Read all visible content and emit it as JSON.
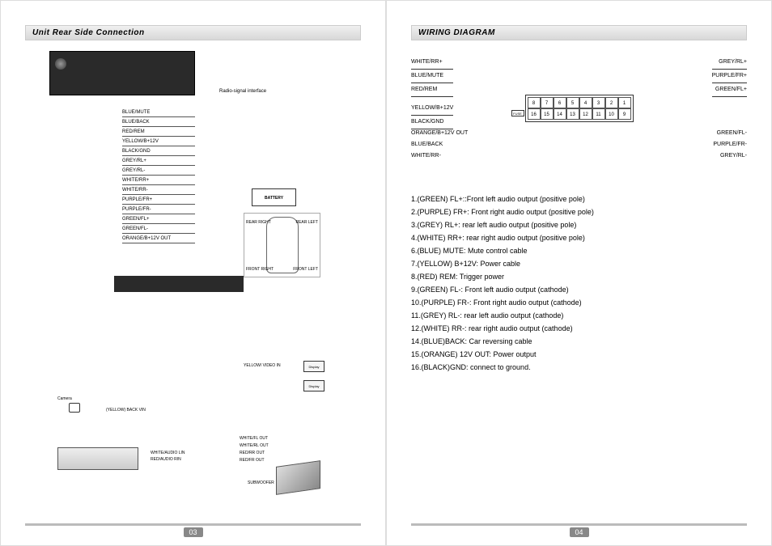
{
  "leftPage": {
    "title": "Unit Rear Side Connection",
    "radioInterface": "Radio-signal interface",
    "upperWires": [
      "BLUE/MUTE",
      "BLUE/BACK",
      "RED/REM",
      "YELLOW/B+12V",
      "BLACK/GND",
      "GREY/RL+",
      "GREY/RL-",
      "WHITE/RR+",
      "WHITE/RR-",
      "PURPLE/FR+",
      "PURPLE/FR-",
      "GREEN/FL+",
      "GREEN/FL-",
      "ORANGE/B+12V OUT"
    ],
    "battery": "BATTERY",
    "carLabels": {
      "rr": "REAR RIGHT",
      "rl": "REAR LEFT",
      "fr": "FRONT RIGHT",
      "fl": "FRONT LEFT"
    },
    "camera": "Camera",
    "cameraWire": "(YELLOW) BACK VIN",
    "audioIn": [
      "WHITE/AUDIO LIN",
      "RED/AUDIO RIN"
    ],
    "videoIn": "YELLOW/ VIDEO IN",
    "display": "Display",
    "outWires": [
      "WHITE/FL OUT",
      "WHITE/RL OUT",
      "RED/RR OUT",
      "RED/FR OUT"
    ],
    "subwoofer": "SUBWOOFER",
    "pageNum": "03"
  },
  "rightPage": {
    "title": "WIRING DIAGRAM",
    "leftTop": [
      "WHITE/RR+",
      "BLUE/MUTE",
      "RED/REM",
      "YELLOW/B+12V",
      "BLACK/GND"
    ],
    "rightTop": [
      "GREY/RL+",
      "PURPLE/FR+",
      "GREEN/FL+"
    ],
    "leftBottom": [
      "ORANGE/B+12V  OUT",
      "BLUE/BACK",
      "WHITE/RR-"
    ],
    "rightBottom": [
      "GREEN/FL-",
      "PURPLE/FR-",
      "GREY/RL-"
    ],
    "pinsTop": [
      "8",
      "7",
      "6",
      "5",
      "4",
      "3",
      "2",
      "1"
    ],
    "pinsBottom": [
      "16",
      "15",
      "14",
      "13",
      "12",
      "11",
      "10",
      "9"
    ],
    "fuse": "FUSE",
    "legend": [
      "1.(GREEN) FL+::Front left audio output (positive pole)",
      "2.(PURPLE) FR+: Front right audio output (positive pole)",
      "3.(GREY) RL+: rear left audio output (positive pole)",
      "4.(WHITE) RR+: rear right audio output (positive pole)",
      "6.(BLUE) MUTE: Mute control cable",
      "7.(YELLOW) B+12V: Power cable",
      "8.(RED) REM: Trigger power",
      "9.(GREEN) FL-: Front left audio output (cathode)",
      "10.(PURPLE) FR-: Front right audio output (cathode)",
      "11.(GREY)  RL-: rear left audio output (cathode)",
      "12.(WHITE) RR-: rear right audio output (cathode)",
      "14.(BLUE)BACK: Car reversing cable",
      "15.(ORANGE) 12V OUT: Power output",
      "16.(BLACK)GND: connect to ground."
    ],
    "pageNum": "04"
  }
}
